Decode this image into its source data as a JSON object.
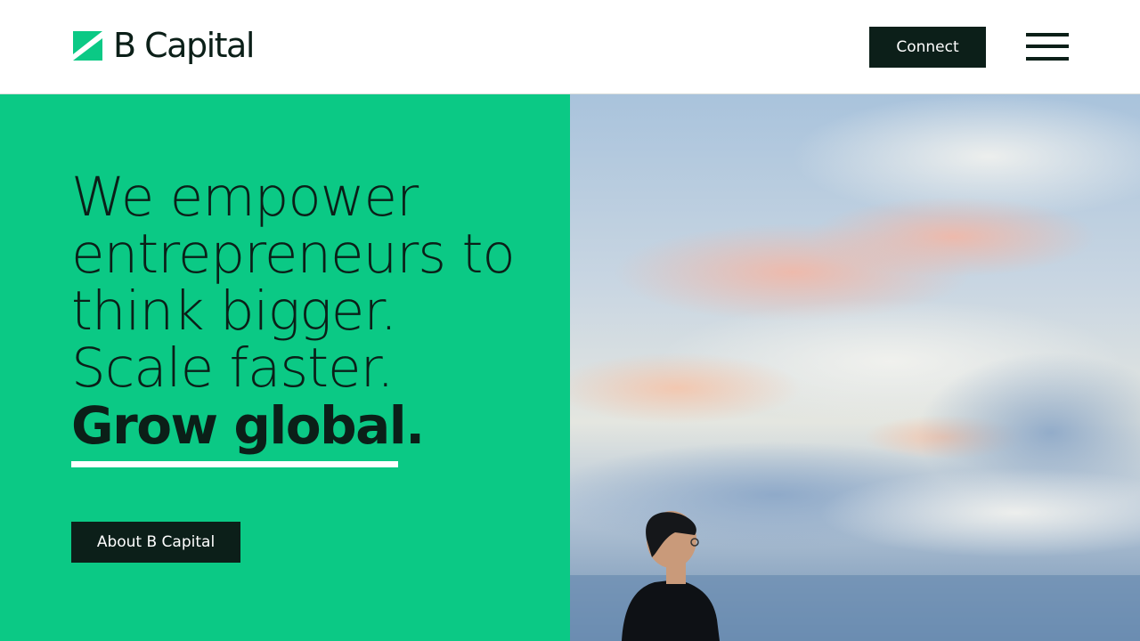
{
  "header": {
    "brand": "B Capital",
    "connect_label": "Connect",
    "menu_icon": "hamburger-menu-icon"
  },
  "hero": {
    "headline_lines": [
      "We empower",
      "entrepreneurs to",
      "think bigger.",
      "Scale faster."
    ],
    "headline_bold": "Grow global.",
    "cta_label": "About B Capital",
    "image": "photo-man-looking-at-sky"
  },
  "colors": {
    "brand_green": "#0bc985",
    "dark": "#0c1f19",
    "white": "#ffffff"
  }
}
